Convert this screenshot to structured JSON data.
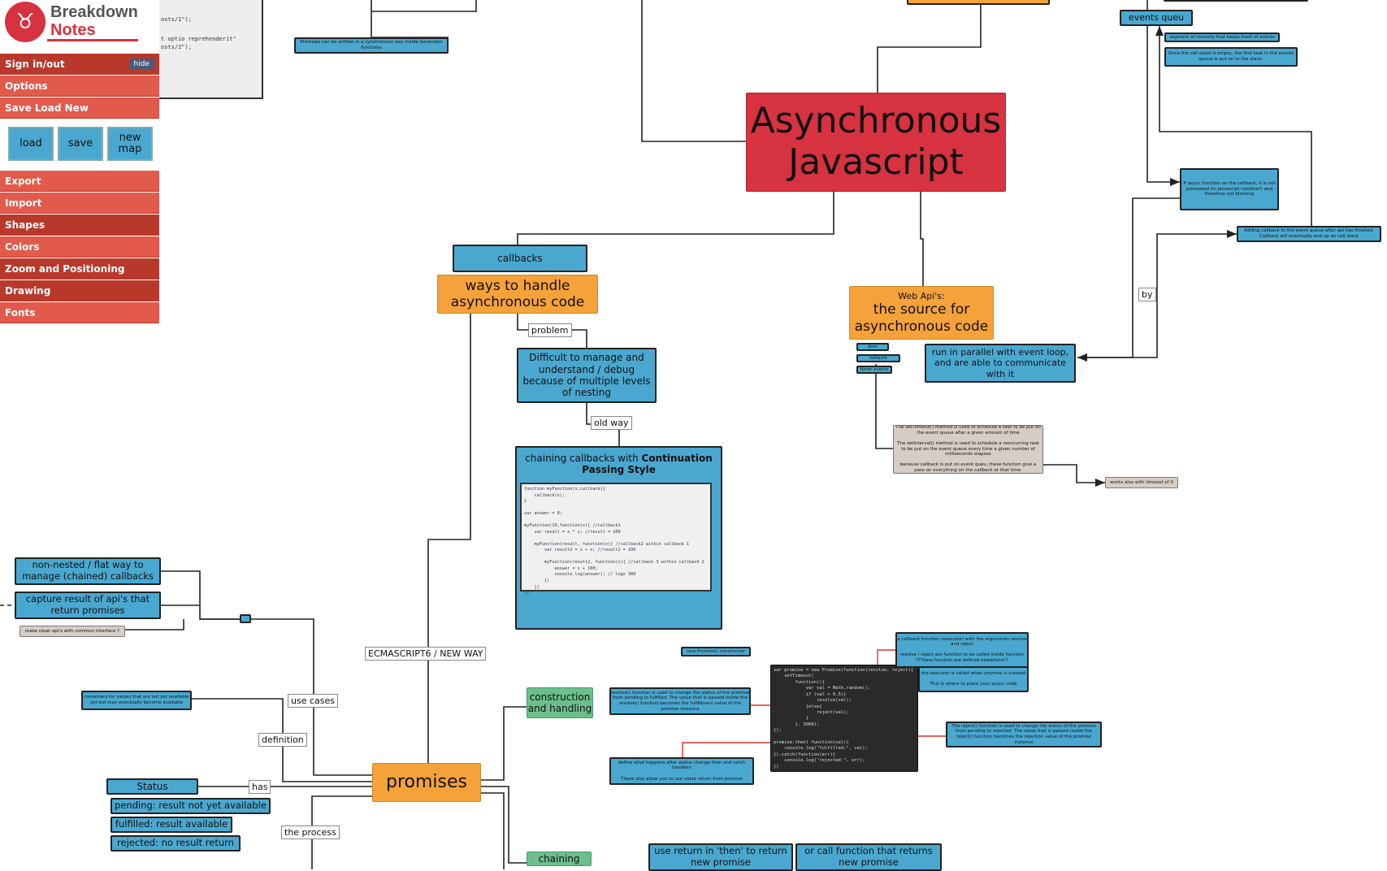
{
  "sidebar": {
    "logo_line1": "Breakdown",
    "logo_line2": "Notes",
    "menu": [
      "Sign in/out",
      "Options",
      "Save Load New"
    ],
    "hide_label": "hide",
    "buttons": [
      "load",
      "save",
      "new map"
    ],
    "menu2": [
      "Export",
      "Import",
      "Shapes",
      "Colors",
      "Zoom and Positioning",
      "Drawing",
      "Fonts"
    ]
  },
  "partial_code": {
    "line1": "osts/1\");",
    "line2": "t optio reprehenderit\"",
    "line3": "osts/2\");"
  },
  "nodes": {
    "title": "Asynchronous Javascript",
    "generators": "Promises can be written in a synchronous way inside Generator functions",
    "callbacks": "callbacks",
    "ways": "ways to handle asynchronous code",
    "difficult": "Difficult to manage and understand / debug because of multiple levels of nesting",
    "cps_text": "chaining callbacks with ",
    "cps_bold": "Continuation Passing Style",
    "cps_code": "function myFunction(x,callback){\n    callback(x);\n}\n\nvar answer = 0;\n\nmyFunction(10,function(x){ //callback1\n    var result = x * x; //result = 100\n\n    myFunction(result, function(x){ //callback2 within callback 1\n        var result2 = x + x; //result2 = 100\n\n        myFunction(result2, function(x){ //callback 3 within callback 2\n            answer = x + 100;\n            console.log(answer); // logs 300\n        })\n    })\n});",
    "webapi_head": "Web Api's:",
    "webapi_main": "the source for asynchronous code",
    "webapi_sub": [
      "dom",
      "network",
      "timer events"
    ],
    "parallel": "run in parallel with event loop, and are able to communicate with it",
    "events_queue": "events queu",
    "segment": "segment of memory that keeps track of events",
    "once": "Once the call stack is empty, the first task in the events queue is put on to the stack.",
    "if_async": "If async function on the callback, it is not processed (in javascript runtime?) and therefore not blocking",
    "adding": "Adding callback to the event queue after api has finished. Callback will eventually end up on call stack",
    "settimeout": "The setTimeout() method is used to schedule a task to be put on the event queue after a given amount of time\n\nThe setInterval() method is used to schedule a reoccurring task to be put on the event queue every time a given number of milliseconds elapses\n\nbecause callback is put on event queu, these function give a pass on everything on the callback at that time.",
    "timeout0": "works also with timeout of 0",
    "nonnested": "non-nested / flat way to manage (chained) callbacks",
    "capture": "capture result of api's that return promises",
    "cleanapi": "make clean api's with common interface ?",
    "containers": "containers for values that are not yet available yet but may eventually become available",
    "status": "Status",
    "pending": "pending: result not yet available",
    "fulfilled": "fulfilled: result available",
    "rejected": "rejected: no result return",
    "promises": "promises",
    "construction": "construction and handling",
    "chaining": "chaining",
    "new_promise": "new Promise() constructor",
    "executor": "a callback function (executor) with the arguments resolve and reject\n\nresolve / reject are function to be called inside function\n???here function are defined elsewhere??",
    "executor_called": "the executor is called when promise is created\n\nThis is where to place your async code",
    "resolve_desc": "resolve() function is used to change the status of the promise from pending to fulfilled. The value that is passed inside the resolve() function becomes the fulfillment value of the promise instance",
    "reject_desc": "The reject() function is used to change the status of the promise from pending to rejected. The value that is passed inside the reject() function becomes the rejection value of the promise instance",
    "then_desc": "define what happens after status change then and catch handlers\n\nThese also allow you to use value return from promise",
    "promise_code": "var promise = new Promise(function(resolve, reject){\n    setTimeout(\n        function(){\n            var val = Math.random();\n            if (val > 0.5){\n                resolve(val);\n            }else{\n                reject(val);\n            }\n        }, 3000);\n});\n\npromise.then( function(val){\n    console.log(\"fulfilled:\", val);\n}).catch(function(err){\n    console.log(\"rejected:\", err);\n})",
    "use_return": "use return in 'then' to return new promise",
    "call_function": "or call function that returns new promise"
  },
  "labels": {
    "problem": "problem",
    "old_way": "old way",
    "es6": "ECMASCRIPT6 / NEW WAY",
    "use_cases": "use cases",
    "definition": "definition",
    "has": "has",
    "the_process": "the process",
    "by": "by"
  },
  "colors": {
    "node_blue": "#4aa8d0",
    "node_orange": "#f5a23a",
    "node_green": "#6cbf8c",
    "title_red": "#d7323f",
    "menu_red": "#e25a4b",
    "connector_red": "#e03030"
  }
}
